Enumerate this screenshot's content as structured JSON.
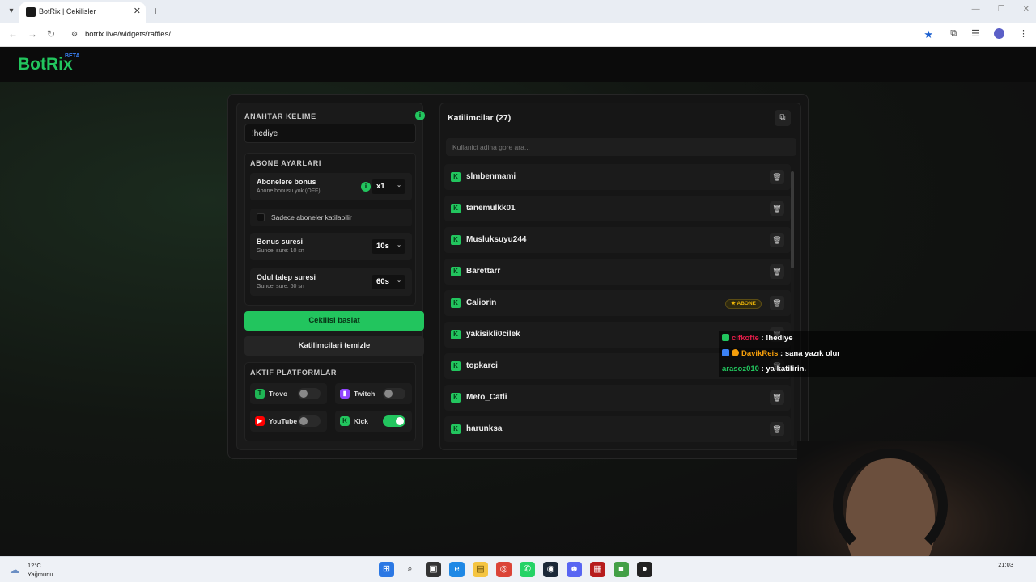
{
  "browser": {
    "tab_title": "BotRix | Cekilisler",
    "url": "botrix.live/widgets/raffles/"
  },
  "app": {
    "logo": "BotRix",
    "logo_badge": "BETA"
  },
  "keyword": {
    "title": "ANAHTAR KELIME",
    "value": "!hediye"
  },
  "subscriber_settings": {
    "title": "ABONE AYARLARI",
    "bonus": {
      "title": "Abonelere bonus",
      "subtitle": "Abone bonusu yok (OFF)",
      "value": "x1"
    },
    "only_subs_label": "Sadece aboneler katilabilir",
    "bonus_time": {
      "title": "Bonus suresi",
      "subtitle": "Guncel sure: 10 sn",
      "value": "10s"
    },
    "claim_time": {
      "title": "Odul talep suresi",
      "subtitle": "Guncel sure: 60 sn",
      "value": "60s"
    }
  },
  "actions": {
    "start": "Cekilisi baslat",
    "clear": "Katilimcilari temizle"
  },
  "platforms": {
    "title": "AKTIF PLATFORMLAR",
    "items": [
      {
        "name": "Trovo",
        "enabled": false,
        "color": "#1fb655"
      },
      {
        "name": "Twitch",
        "enabled": false,
        "color": "#9146ff"
      },
      {
        "name": "YouTube",
        "enabled": false,
        "color": "#ff0000"
      },
      {
        "name": "Kick",
        "enabled": true,
        "color": "#22c55e"
      }
    ]
  },
  "participants": {
    "title": "Katilimcilar (27)",
    "search_placeholder": "Kullanici adina gore ara...",
    "abone_label": "★ ABONE",
    "list": [
      {
        "name": "slmbenmami"
      },
      {
        "name": "tanemulkk01"
      },
      {
        "name": "Musluksuyu244"
      },
      {
        "name": "Barettarr"
      },
      {
        "name": "Caliorin",
        "subscriber": true
      },
      {
        "name": "yakisikli0cilek"
      },
      {
        "name": "topkarci"
      },
      {
        "name": "Meto_Catli"
      },
      {
        "name": "harunksa"
      }
    ]
  },
  "chat": [
    {
      "user": "cifkofte",
      "message": " : !hediye"
    },
    {
      "user": "DavikReis",
      "message": " : sana yazık olur"
    },
    {
      "user": "arasoz010",
      "message": " : ya katilirin."
    }
  ],
  "taskbar": {
    "temp": "12°C",
    "condition": "Yağmurlu",
    "time": "21:03"
  },
  "colors": {
    "accent": "#22c55e",
    "brand_beta": "#3b82f6"
  }
}
